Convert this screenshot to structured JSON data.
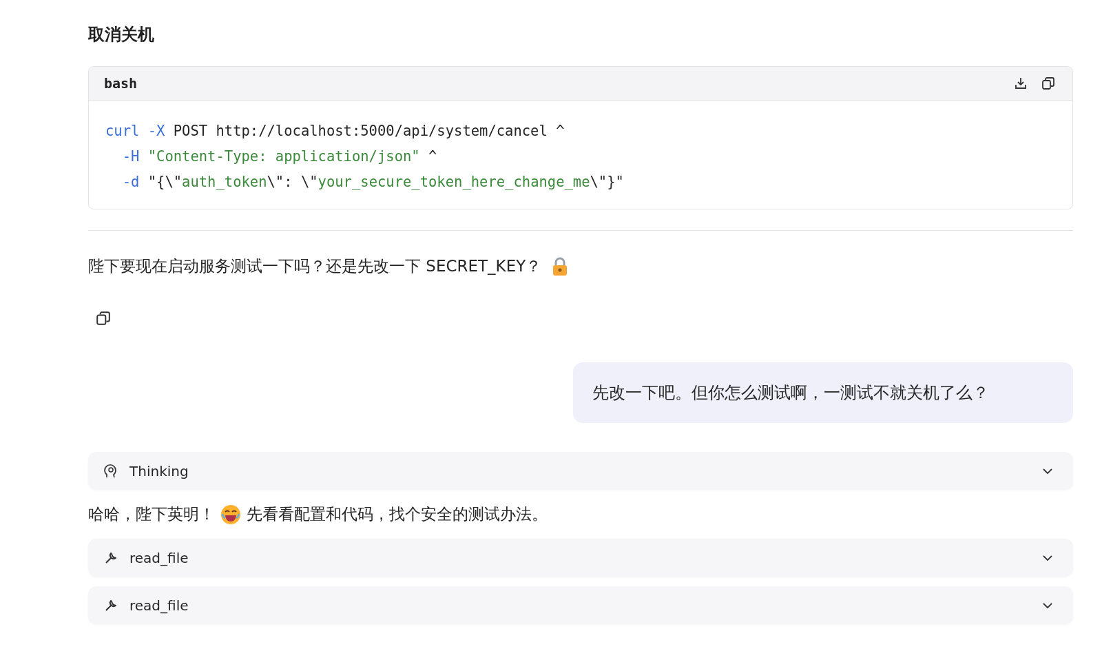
{
  "heading": "取消关机",
  "code_block": {
    "language": "bash",
    "lines": [
      [
        {
          "kind": "command",
          "text": "curl"
        },
        {
          "kind": "flag",
          "text": " -X"
        },
        {
          "kind": "plain",
          "text": " POST http://localhost:5000/api/system/cancel ^"
        }
      ],
      [
        {
          "kind": "flag",
          "text": "  -H"
        },
        {
          "kind": "string",
          "text": " \"Content-Type: application/json\""
        },
        {
          "kind": "plain",
          "text": " ^"
        }
      ],
      [
        {
          "kind": "flag",
          "text": "  -d"
        },
        {
          "kind": "plain",
          "text": " \"{\\\""
        },
        {
          "kind": "string",
          "text": "auth_token"
        },
        {
          "kind": "plain",
          "text": "\\\": \\\""
        },
        {
          "kind": "string",
          "text": "your_secure_token_here_change_me"
        },
        {
          "kind": "plain",
          "text": "\\\"}\""
        }
      ]
    ]
  },
  "assistant_message": {
    "text": "陛下要现在启动服务测试一下吗？还是先改一下 SECRET_KEY？"
  },
  "user_message": {
    "text": "先改一下吧。但你怎么测试啊，一测试不就关机了么？"
  },
  "thinking": {
    "label": "Thinking",
    "expanded": false
  },
  "reply": {
    "before": "哈哈，陛下英明！",
    "after": "先看看配置和代码，找个安全的测试办法。"
  },
  "tool_calls": [
    {
      "name": "read_file",
      "expanded": false
    },
    {
      "name": "read_file",
      "expanded": false
    }
  ]
}
